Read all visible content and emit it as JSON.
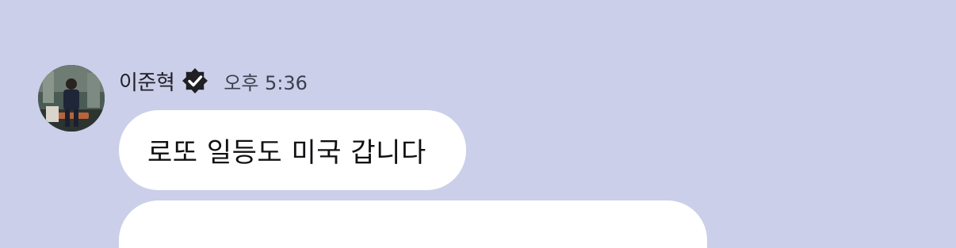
{
  "message": {
    "sender": "이준혁",
    "time": "오후 5:36",
    "text": "로또 일등도 미국 갑니다"
  },
  "colors": {
    "background": "#cbcfe9",
    "bubble": "#ffffff",
    "verified_badge": "#1f1f24"
  }
}
